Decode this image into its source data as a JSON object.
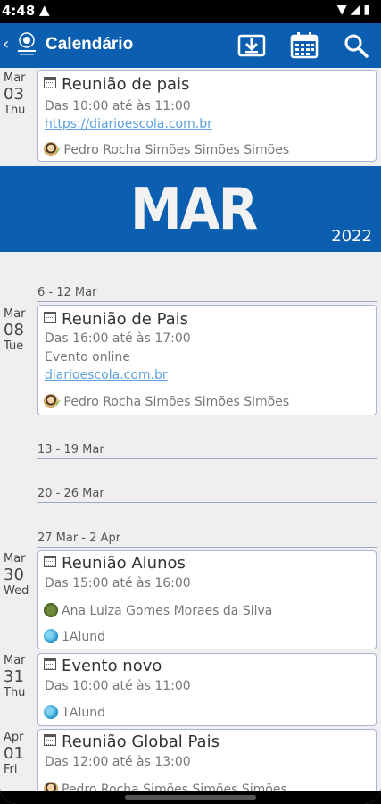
{
  "status": {
    "time": "4:48",
    "alert_icon": "warning-icon"
  },
  "appbar": {
    "title": "Calendário",
    "color": "#0c5fb0"
  },
  "banner": {
    "month": "MAR",
    "year": "2022"
  },
  "events": [
    {
      "month": "Mar",
      "day": "03",
      "weekday": "Thu",
      "title": "Reunião de pais",
      "time": "Das 10:00 até às 11:00",
      "link": "https://diarioescola.com.br",
      "person": "Pedro Rocha Simões Simões Simões"
    },
    {
      "month": "Mar",
      "day": "08",
      "weekday": "Tue",
      "title": "Reunião de Pais",
      "time": "Das 16:00 até às 17:00",
      "note": "Evento online",
      "link": "diarioescola.com.br",
      "person": "Pedro Rocha Simões Simões Simões"
    },
    {
      "month": "Mar",
      "day": "30",
      "weekday": "Wed",
      "title": "Reunião Alunos",
      "time": "Das 15:00 até às 16:00",
      "person": "Ana Luiza Gomes Moraes da Silva",
      "group": "1Alund"
    },
    {
      "month": "Mar",
      "day": "31",
      "weekday": "Thu",
      "title": "Evento novo",
      "time": "Das 10:00 até às 11:00",
      "group": "1Alund"
    },
    {
      "month": "Apr",
      "day": "01",
      "weekday": "Fri",
      "title": "Reunião Global Pais",
      "time": "Das 12:00 até às 13:00",
      "person": "Pedro Rocha Simões Simões Simões"
    }
  ],
  "weeks": [
    "6 - 12 Mar",
    "13 - 19 Mar",
    "20 - 26 Mar",
    "27 Mar - 2 Apr"
  ]
}
